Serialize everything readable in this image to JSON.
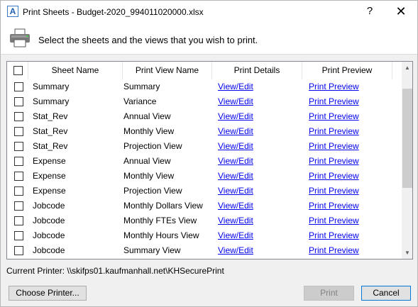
{
  "window": {
    "title": "Print Sheets - Budget-2020_994011020000.xlsx",
    "app_icon_letter": "A",
    "help_glyph": "?",
    "close_glyph": "✕"
  },
  "header": {
    "instruction": "Select the sheets and the views that you wish to print."
  },
  "grid": {
    "columns": [
      "Sheet Name",
      "Print View Name",
      "Print Details",
      "Print Preview"
    ],
    "rows": [
      {
        "sheet": "Summary",
        "view": "Summary",
        "details": "View/Edit",
        "preview": "Print Preview"
      },
      {
        "sheet": "Summary",
        "view": "Variance",
        "details": "View/Edit",
        "preview": "Print Preview"
      },
      {
        "sheet": "Stat_Rev",
        "view": "Annual View",
        "details": "View/Edit",
        "preview": "Print Preview"
      },
      {
        "sheet": "Stat_Rev",
        "view": "Monthly View",
        "details": "View/Edit",
        "preview": "Print Preview"
      },
      {
        "sheet": "Stat_Rev",
        "view": "Projection View",
        "details": "View/Edit",
        "preview": "Print Preview"
      },
      {
        "sheet": "Expense",
        "view": "Annual View",
        "details": "View/Edit",
        "preview": "Print Preview"
      },
      {
        "sheet": "Expense",
        "view": "Monthly View",
        "details": "View/Edit",
        "preview": "Print Preview"
      },
      {
        "sheet": "Expense",
        "view": "Projection View",
        "details": "View/Edit",
        "preview": "Print Preview"
      },
      {
        "sheet": "Jobcode",
        "view": "Monthly Dollars View",
        "details": "View/Edit",
        "preview": "Print Preview"
      },
      {
        "sheet": "Jobcode",
        "view": "Monthly FTEs View",
        "details": "View/Edit",
        "preview": "Print Preview"
      },
      {
        "sheet": "Jobcode",
        "view": "Monthly Hours View",
        "details": "View/Edit",
        "preview": "Print Preview"
      },
      {
        "sheet": "Jobcode",
        "view": "Summary View",
        "details": "View/Edit",
        "preview": "Print Preview"
      }
    ]
  },
  "status": {
    "current_printer": "Current Printer:  \\\\skifps01.kaufmanhall.net\\KHSecurePrint"
  },
  "buttons": {
    "choose_printer": "Choose Printer...",
    "print": "Print",
    "cancel": "Cancel"
  },
  "colors": {
    "link": "#0000ee",
    "focus_border": "#0078d7"
  },
  "icons": {
    "header": "printer-icon",
    "scroll_up": "chevron-up-icon",
    "scroll_down": "chevron-down-icon"
  }
}
